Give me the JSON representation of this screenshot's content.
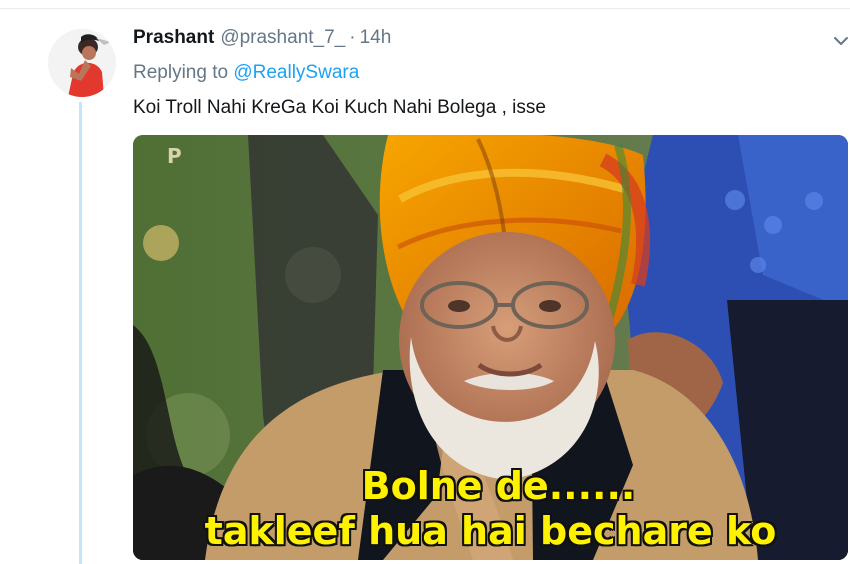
{
  "tweet": {
    "display_name": "Prashant",
    "handle": "@prashant_7_",
    "separator": "·",
    "timestamp": "14h",
    "replying_prefix": "Replying to",
    "replying_to": "@ReallySwara",
    "text": "Koi Troll Nahi KreGa Koi Kuch Nahi Bolega , isse",
    "menu_icon": "chevron-down-icon"
  },
  "media": {
    "caption_line1": "Bolne de......",
    "caption_line2": "takleef hua hai bechare ko",
    "watermark": "P"
  },
  "colors": {
    "name": "#14171a",
    "secondary": "#657786",
    "link": "#1da1f2",
    "thread_line": "#c4e6f6",
    "caption": "#fff200"
  }
}
